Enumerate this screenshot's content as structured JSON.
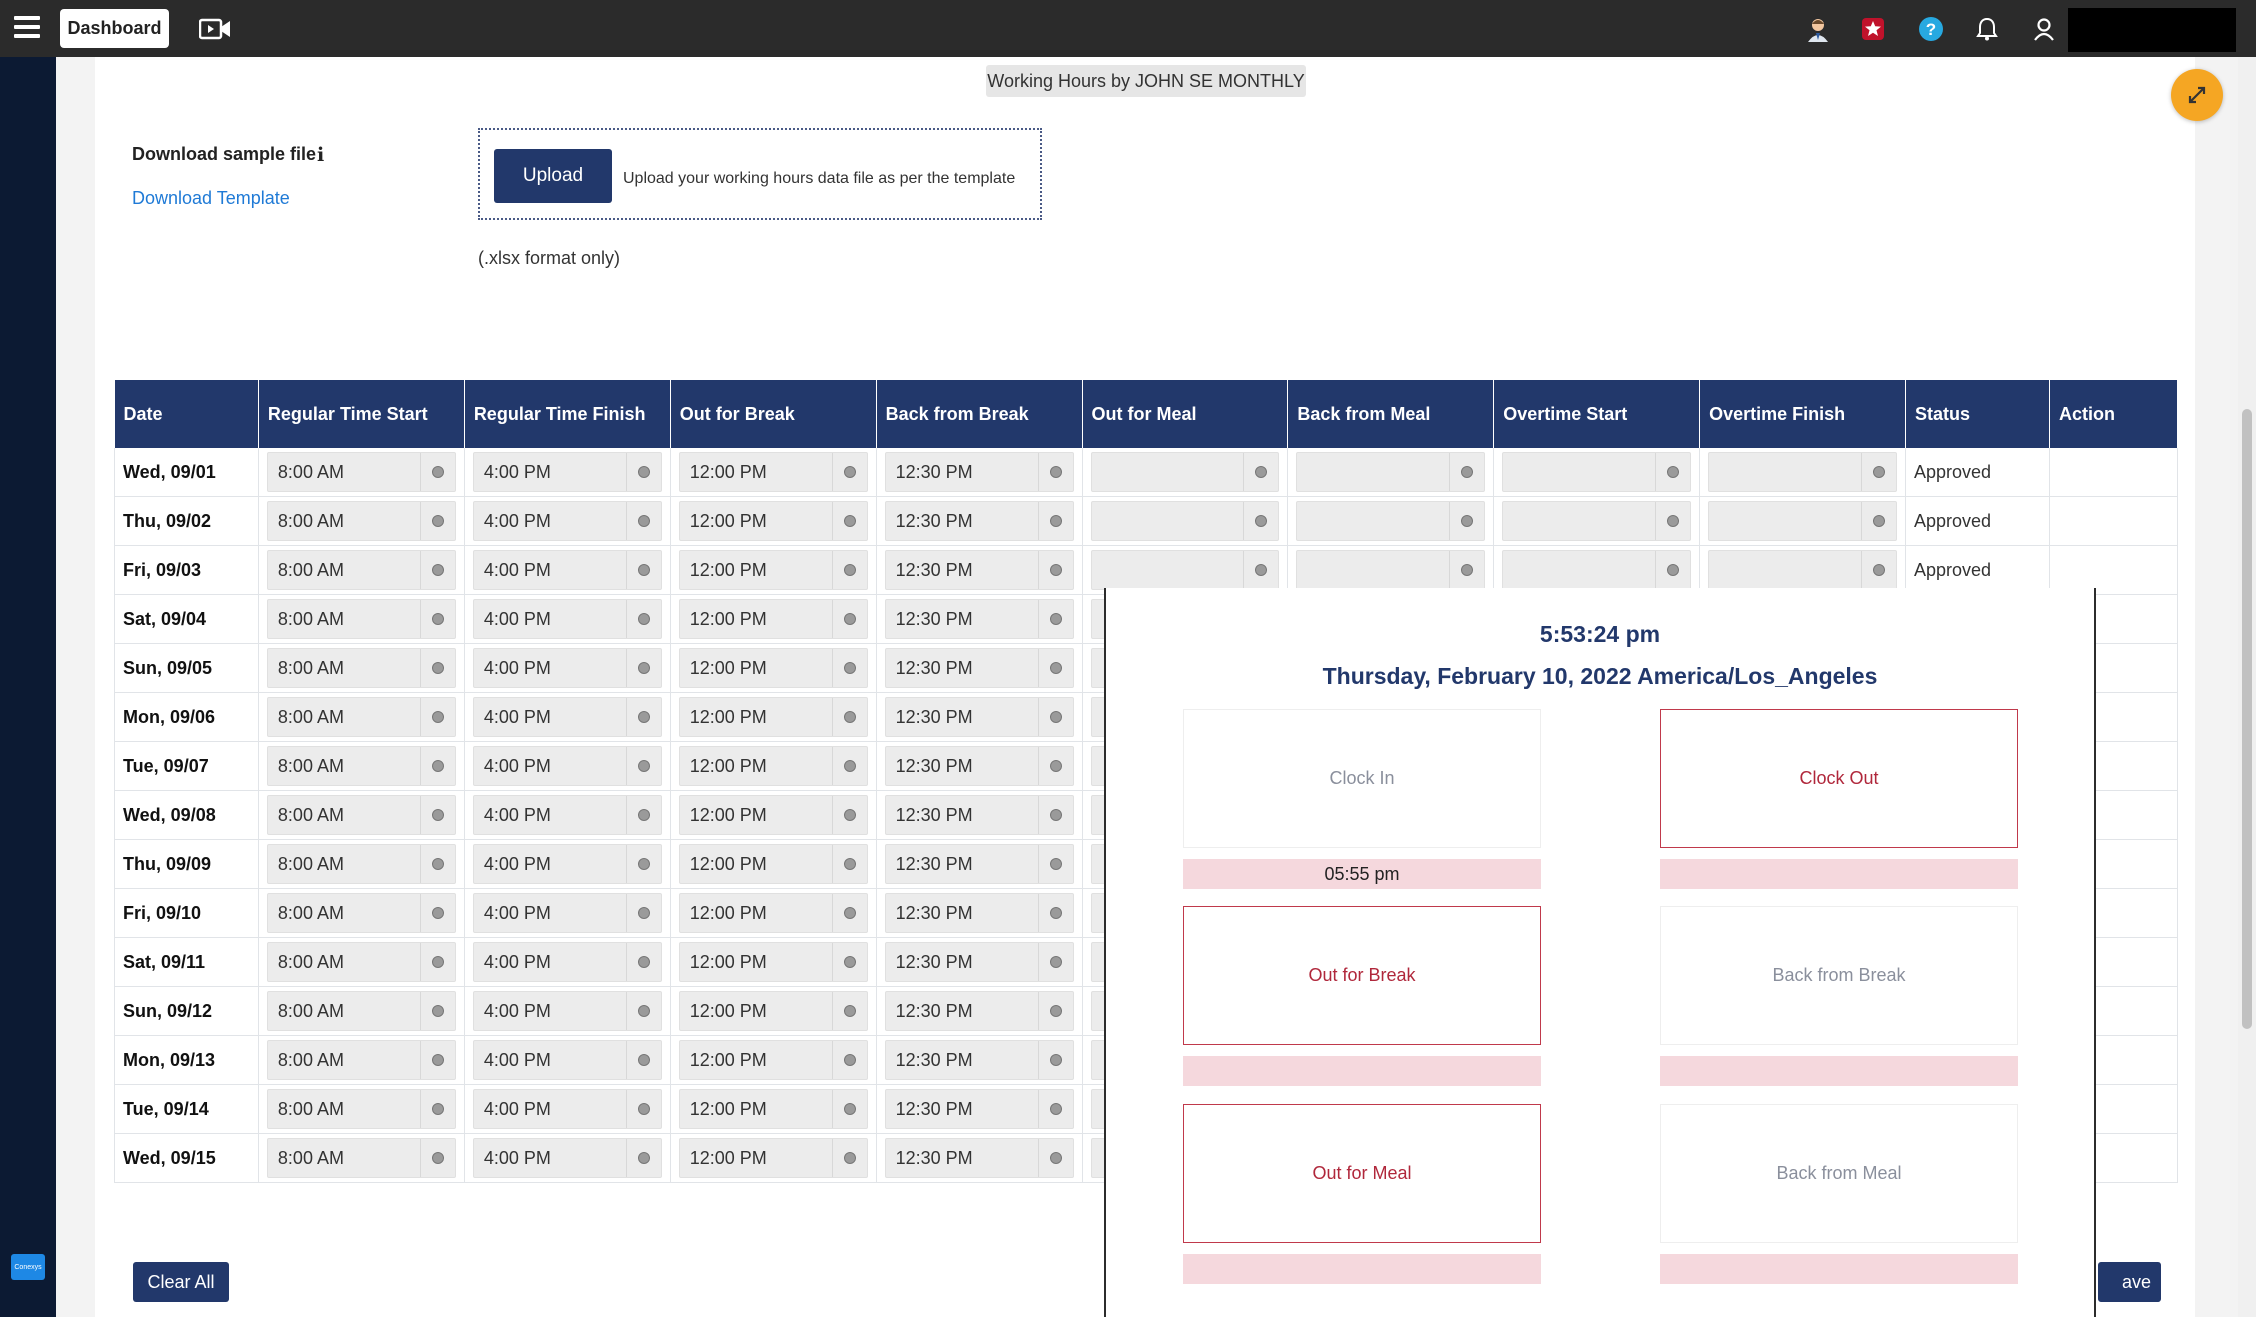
{
  "topbar": {
    "dashboard_label": "Dashboard",
    "icons": [
      "menu-icon",
      "video-icon",
      "user-avatar-icon",
      "star-badge-icon",
      "help-icon",
      "bell-icon",
      "account-icon"
    ]
  },
  "page": {
    "title": "Working Hours by JOHN SE MONTHLY",
    "download_sample_label": "Download sample file",
    "download_template_link": "Download Template",
    "upload_button": "Upload",
    "upload_hint": "Upload your working hours data file as per the template",
    "format_note": "(.xlsx format only)"
  },
  "table": {
    "columns": [
      "Date",
      "Regular Time Start",
      "Regular Time Finish",
      "Out for Break",
      "Back from Break",
      "Out for Meal",
      "Back from Meal",
      "Overtime Start",
      "Overtime Finish",
      "Status",
      "Action"
    ],
    "rows": [
      {
        "date": "Wed, 09/01",
        "start": "8:00 AM",
        "finish": "4:00 PM",
        "out_break": "12:00 PM",
        "back_break": "12:30 PM",
        "status": "Approved"
      },
      {
        "date": "Thu, 09/02",
        "start": "8:00 AM",
        "finish": "4:00 PM",
        "out_break": "12:00 PM",
        "back_break": "12:30 PM",
        "status": "Approved"
      },
      {
        "date": "Fri, 09/03",
        "start": "8:00 AM",
        "finish": "4:00 PM",
        "out_break": "12:00 PM",
        "back_break": "12:30 PM",
        "status": "Approved"
      },
      {
        "date": "Sat, 09/04",
        "start": "8:00 AM",
        "finish": "4:00 PM",
        "out_break": "12:00 PM",
        "back_break": "12:30 PM",
        "status": ""
      },
      {
        "date": "Sun, 09/05",
        "start": "8:00 AM",
        "finish": "4:00 PM",
        "out_break": "12:00 PM",
        "back_break": "12:30 PM",
        "status": ""
      },
      {
        "date": "Mon, 09/06",
        "start": "8:00 AM",
        "finish": "4:00 PM",
        "out_break": "12:00 PM",
        "back_break": "12:30 PM",
        "status": ""
      },
      {
        "date": "Tue, 09/07",
        "start": "8:00 AM",
        "finish": "4:00 PM",
        "out_break": "12:00 PM",
        "back_break": "12:30 PM",
        "status": ""
      },
      {
        "date": "Wed, 09/08",
        "start": "8:00 AM",
        "finish": "4:00 PM",
        "out_break": "12:00 PM",
        "back_break": "12:30 PM",
        "status": ""
      },
      {
        "date": "Thu, 09/09",
        "start": "8:00 AM",
        "finish": "4:00 PM",
        "out_break": "12:00 PM",
        "back_break": "12:30 PM",
        "status": ""
      },
      {
        "date": "Fri, 09/10",
        "start": "8:00 AM",
        "finish": "4:00 PM",
        "out_break": "12:00 PM",
        "back_break": "12:30 PM",
        "status": ""
      },
      {
        "date": "Sat, 09/11",
        "start": "8:00 AM",
        "finish": "4:00 PM",
        "out_break": "12:00 PM",
        "back_break": "12:30 PM",
        "status": ""
      },
      {
        "date": "Sun, 09/12",
        "start": "8:00 AM",
        "finish": "4:00 PM",
        "out_break": "12:00 PM",
        "back_break": "12:30 PM",
        "status": ""
      },
      {
        "date": "Mon, 09/13",
        "start": "8:00 AM",
        "finish": "4:00 PM",
        "out_break": "12:00 PM",
        "back_break": "12:30 PM",
        "status": ""
      },
      {
        "date": "Tue, 09/14",
        "start": "8:00 AM",
        "finish": "4:00 PM",
        "out_break": "12:00 PM",
        "back_break": "12:30 PM",
        "status": ""
      },
      {
        "date": "Wed, 09/15",
        "start": "8:00 AM",
        "finish": "4:00 PM",
        "out_break": "12:00 PM",
        "back_break": "12:30 PM",
        "status": ""
      }
    ]
  },
  "footer": {
    "clear_all": "Clear All",
    "save_partial": "ave"
  },
  "clock_panel": {
    "time": "5:53:24 pm",
    "date": "Thursday, February 10, 2022 America/Los_Angeles",
    "clock_in": "Clock In",
    "clock_in_time": "05:55 pm",
    "clock_out": "Clock Out",
    "out_for_break": "Out for Break",
    "back_from_break": "Back from Break",
    "out_for_meal": "Out for Meal",
    "back_from_meal": "Back from Meal"
  },
  "sidebar": {
    "badge_text": "Conexys"
  },
  "colors": {
    "brand_navy": "#22386b",
    "accent_orange": "#f5a623",
    "clock_red": "#b0273b",
    "strip_pink": "#f5d8dd"
  }
}
